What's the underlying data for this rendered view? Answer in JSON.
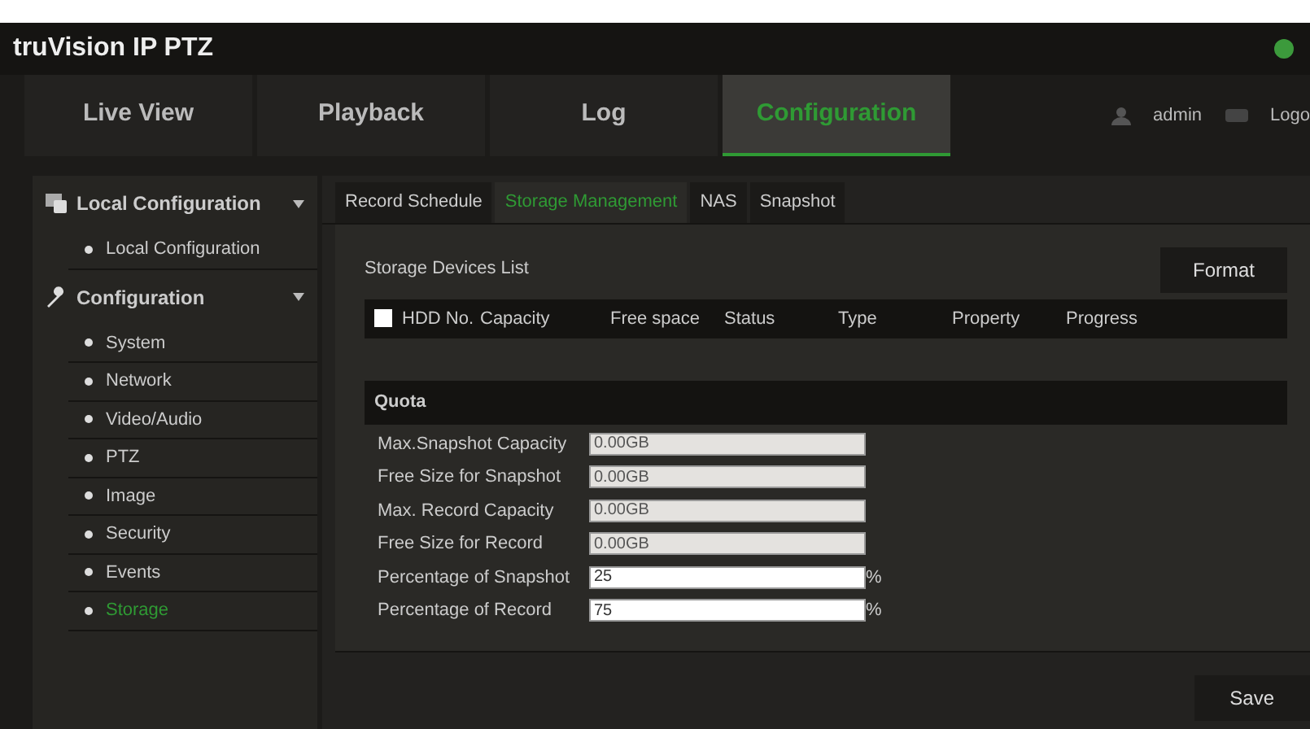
{
  "header": {
    "logo": "truVision IP PTZ"
  },
  "nav": [
    {
      "label": "Live View",
      "selected": false
    },
    {
      "label": "Playback",
      "selected": false
    },
    {
      "label": "Log",
      "selected": false
    },
    {
      "label": "Configuration",
      "selected": true
    }
  ],
  "user": {
    "name": "admin",
    "logout": "Logo"
  },
  "sidebar": [
    {
      "label": "Local Configuration",
      "kind": "local",
      "expanded": true,
      "children": [
        {
          "label": "Local Configuration",
          "selected": false
        }
      ]
    },
    {
      "label": "Configuration",
      "kind": "device",
      "expanded": true,
      "children": [
        {
          "label": "System",
          "selected": false
        },
        {
          "label": "Network",
          "selected": false
        },
        {
          "label": "Video/Audio",
          "selected": false
        },
        {
          "label": "PTZ",
          "selected": false
        },
        {
          "label": "Image",
          "selected": false
        },
        {
          "label": "Security",
          "selected": false
        },
        {
          "label": "Events",
          "selected": false
        },
        {
          "label": "Storage",
          "selected": true
        }
      ]
    }
  ],
  "tabs": [
    {
      "label": "Record Schedule",
      "selected": false
    },
    {
      "label": "Storage Management",
      "selected": true
    },
    {
      "label": "NAS",
      "selected": false
    },
    {
      "label": "Snapshot",
      "selected": false
    }
  ],
  "devices": {
    "title": "Storage Devices List",
    "format_button": "Format",
    "select_all_checked": false,
    "columns": [
      "HDD No.",
      "Capacity",
      "Free space",
      "Status",
      "Type",
      "Property",
      "Progress"
    ]
  },
  "quota": {
    "title": "Quota",
    "fields": [
      {
        "label": "Max.Snapshot Capacity",
        "value": "0.00GB",
        "disabled": true
      },
      {
        "label": "Free Size for Snapshot",
        "value": "0.00GB",
        "disabled": true
      },
      {
        "label": "Max. Record Capacity",
        "value": "0.00GB",
        "disabled": true
      },
      {
        "label": "Free Size for Record",
        "value": "0.00GB",
        "disabled": true
      },
      {
        "label": "Percentage of Snapshot",
        "value": "25",
        "disabled": false,
        "unit": "%"
      },
      {
        "label": "Percentage of Record",
        "value": "75",
        "disabled": false,
        "unit": "%"
      }
    ]
  },
  "save_button": "Save"
}
